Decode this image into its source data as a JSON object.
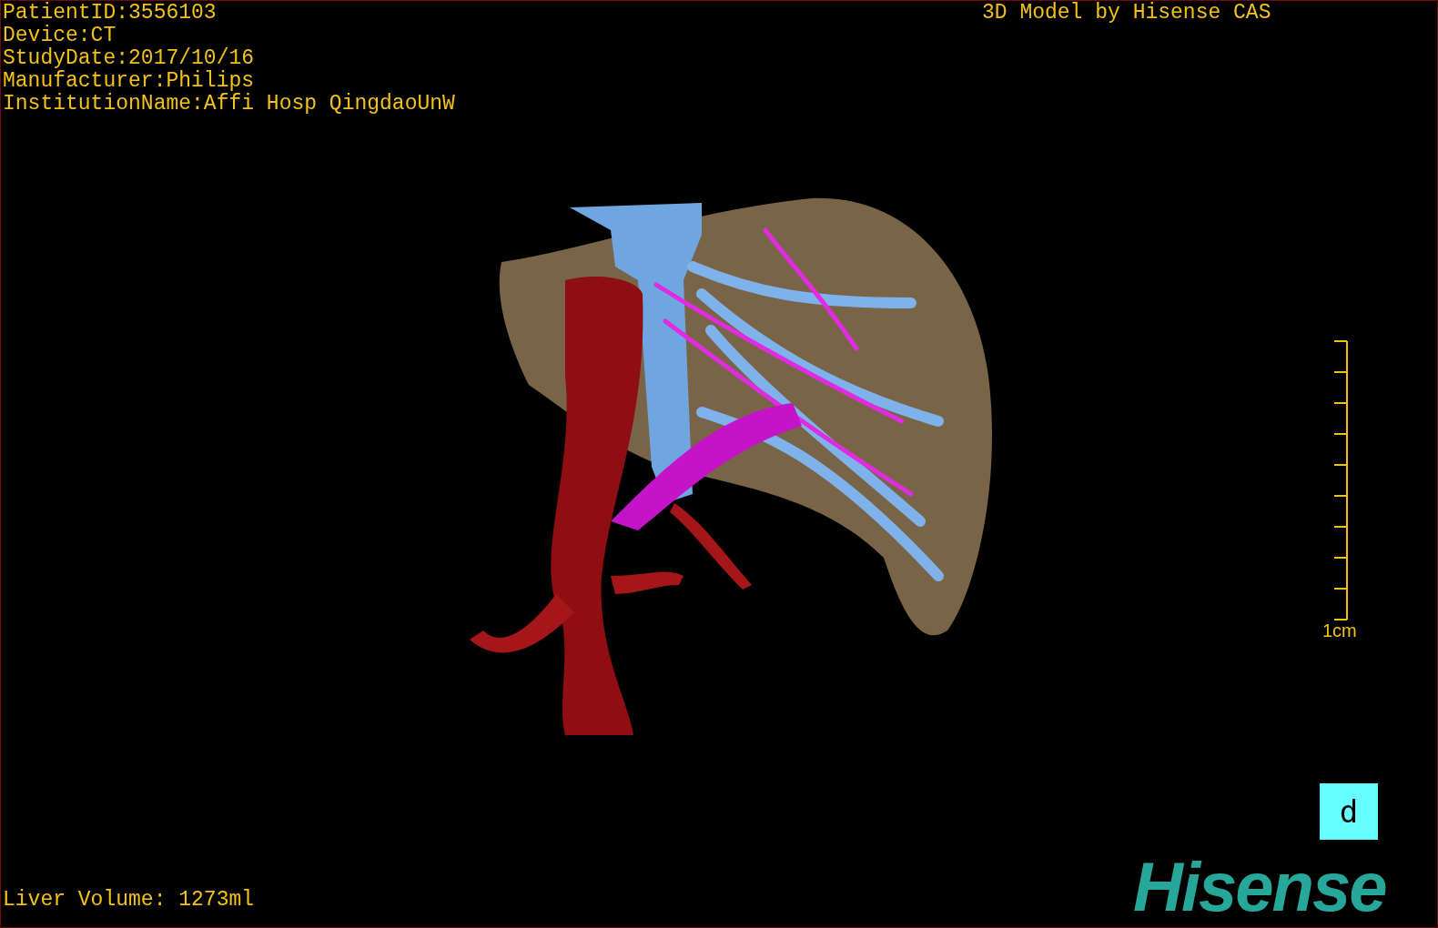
{
  "study_info": [
    "PatientID:3556103",
    "Device:CT",
    "StudyDate:2017/10/16",
    "Manufacturer:Philips",
    "InstitutionName:Affi Hosp QingdaoUnW"
  ],
  "model_title": "3D Model by Hisense CAS",
  "scale": {
    "label": "1cm"
  },
  "orientation_marker": "d",
  "liver_volume": "Liver Volume: 1273ml",
  "logo": "Hisense"
}
